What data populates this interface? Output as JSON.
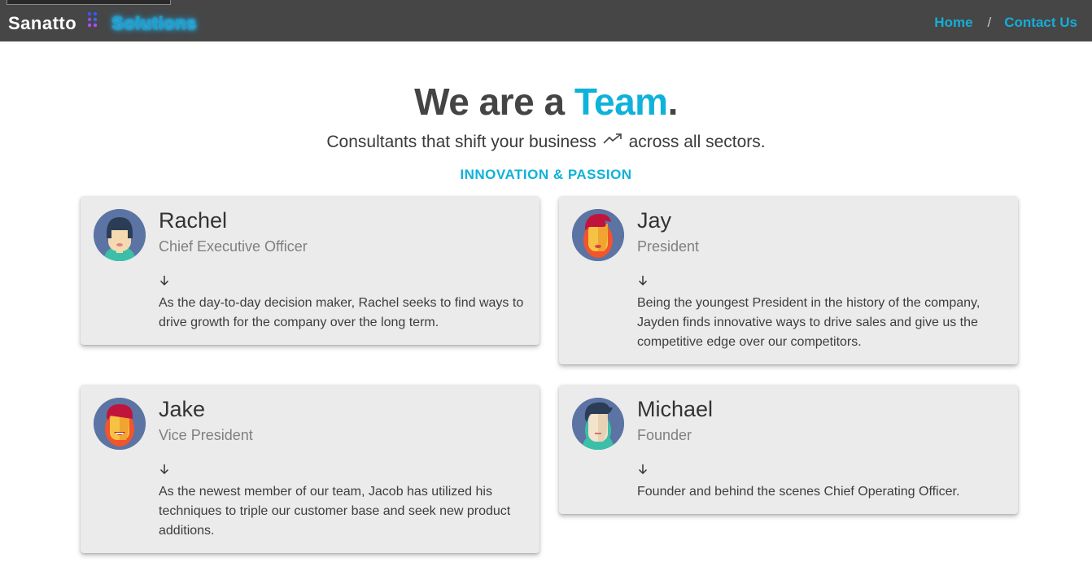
{
  "nav": {
    "brand_name": "Sanatto",
    "brand_accent": "Solutions",
    "links": [
      "Home",
      "Contact Us"
    ],
    "separator": "/"
  },
  "hero": {
    "title_prefix": "We are a ",
    "title_accent": "Team",
    "title_suffix": ".",
    "subtitle_before": "Consultants that shift your business",
    "subtitle_after": "across all sectors.",
    "tagline": "INNOVATION & PASSION"
  },
  "colors": {
    "accent": "#0fb2da",
    "navbar": "#464646",
    "card": "#ebebeb"
  },
  "team": [
    {
      "name": "Rachel",
      "role": "Chief Executive Officer",
      "description": "As the day-to-day decision maker, Rachel seeks to find ways to drive growth for the company over the long term.",
      "avatar_icon": "woman-avatar-icon"
    },
    {
      "name": "Jay",
      "role": "President",
      "description": "Being the youngest President in the history of the company, Jayden finds innovative ways to drive sales and give us the competitive edge over our competitors.",
      "avatar_icon": "man-avatar-icon"
    },
    {
      "name": "Jake",
      "role": "Vice President",
      "description": "As the newest member of our team, Jacob has utilized his techniques to triple our customer base and seek new product additions.",
      "avatar_icon": "man-avatar-icon"
    },
    {
      "name": "Michael",
      "role": "Founder",
      "description": "Founder and behind the scenes Chief Operating Officer.",
      "avatar_icon": "man-avatar-icon"
    }
  ]
}
